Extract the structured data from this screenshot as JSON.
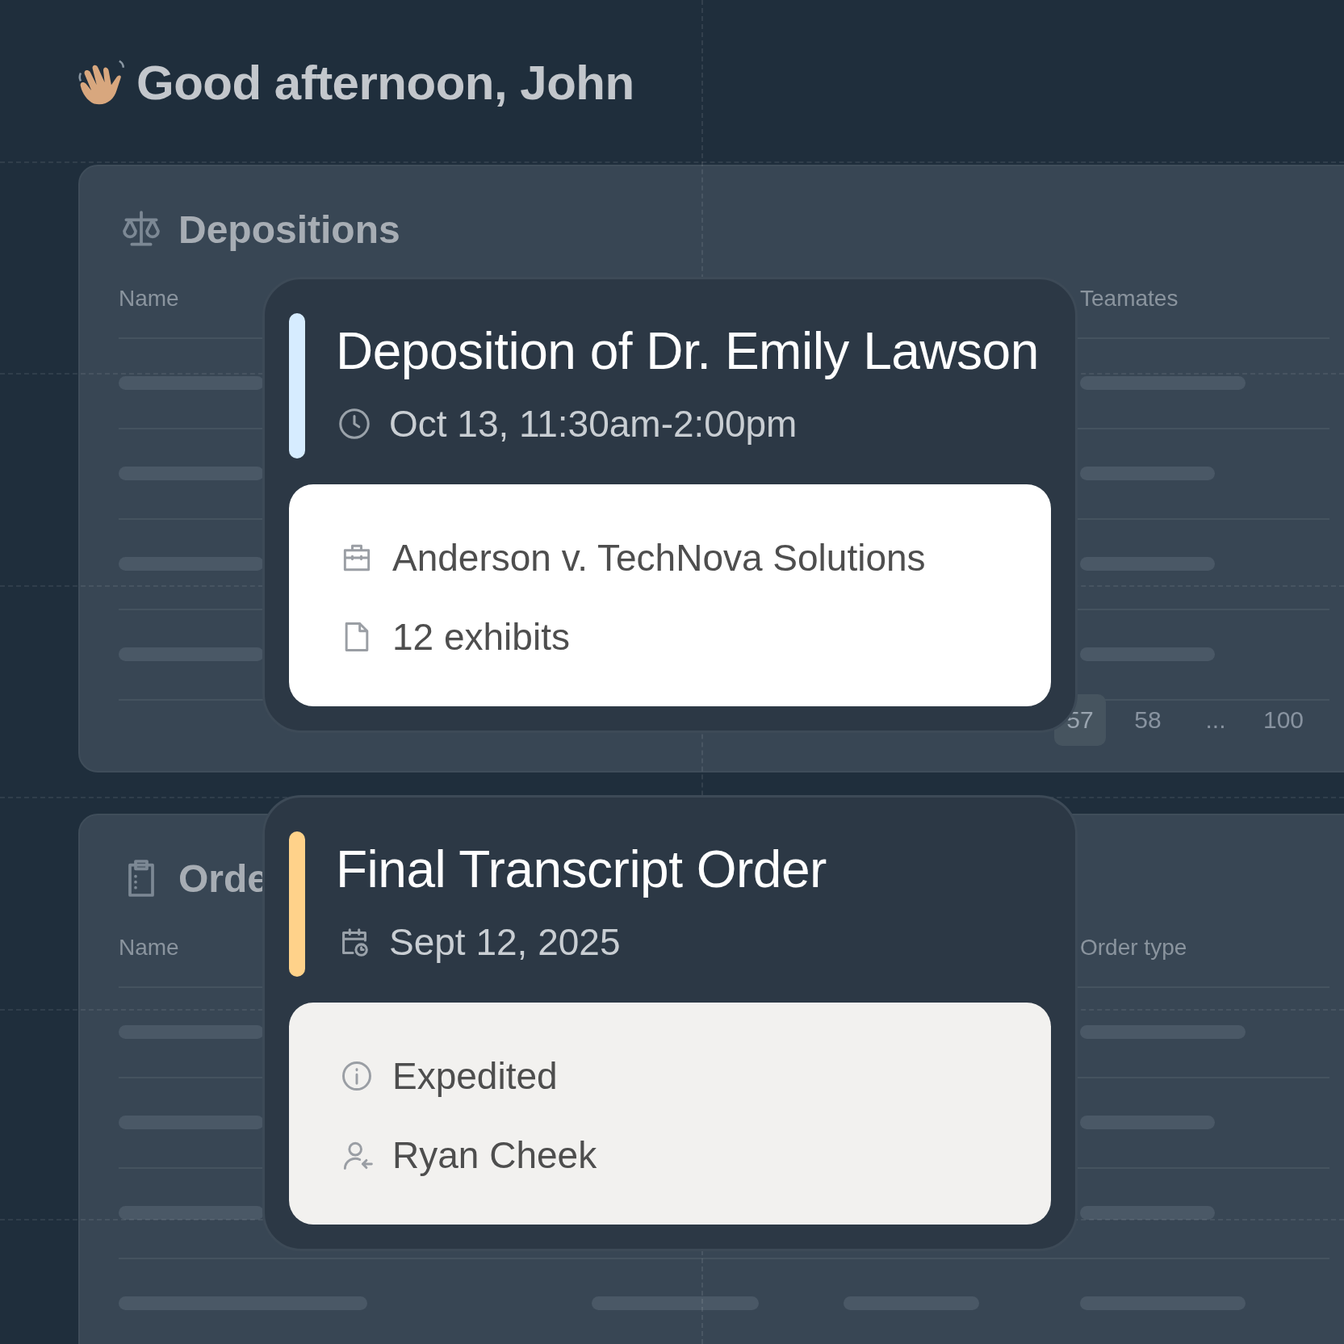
{
  "greeting": "Good afternoon, John",
  "panels": [
    {
      "title": "Depositions",
      "kind": "scale",
      "columns": [
        "Name",
        "Teamates"
      ],
      "pagination": [
        {
          "label": "57",
          "selected": true
        },
        {
          "label": "58",
          "selected": false
        },
        {
          "label": "...",
          "selected": false
        },
        {
          "label": "100",
          "selected": false
        }
      ]
    },
    {
      "title": "Orde",
      "kind": "clipboard",
      "columns": [
        "Name",
        "Order type"
      ]
    }
  ],
  "cards": [
    {
      "kind": "deposition",
      "color": "#d6ecff",
      "title": "Deposition of Dr. Emily Lawson",
      "when": {
        "kind": "clock",
        "text": "Oct 13, 11:30am-2:00pm"
      },
      "details": [
        {
          "kind": "briefcase",
          "text": "Anderson v. TechNova Solutions"
        },
        {
          "kind": "document",
          "text": "12 exhibits"
        }
      ]
    },
    {
      "kind": "order",
      "color": "#ffd28a",
      "title": "Final Transcript Order",
      "when": {
        "kind": "calendar",
        "text": "Sept 12, 2025"
      },
      "details": [
        {
          "kind": "info",
          "text": "Expedited"
        },
        {
          "kind": "person",
          "text": "Ryan Cheek"
        }
      ]
    }
  ]
}
